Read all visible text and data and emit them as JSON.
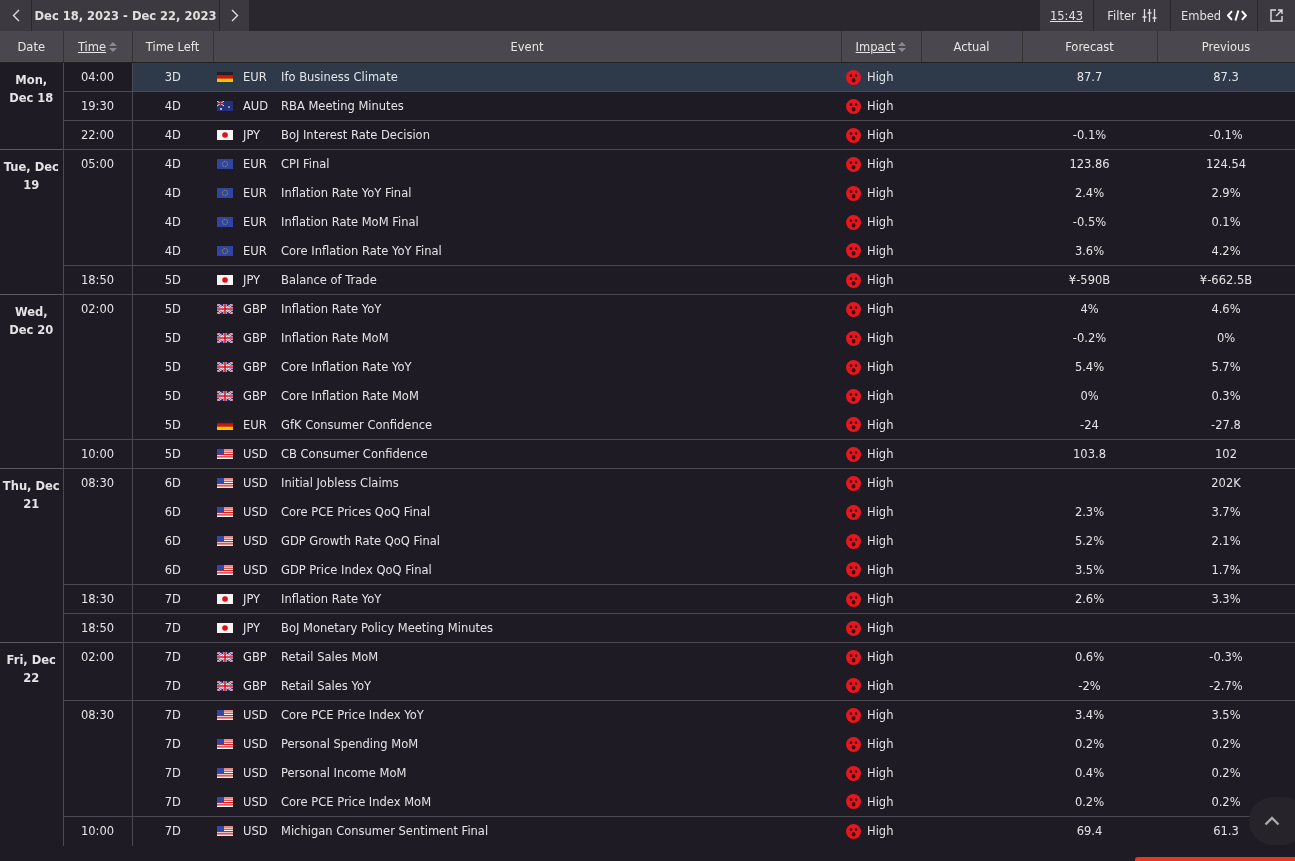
{
  "toolbar": {
    "date_range": "Dec 18, 2023 - Dec 22, 2023",
    "time": "15:43",
    "filter": "Filter",
    "embed": "Embed"
  },
  "table": {
    "columns": [
      {
        "label": "Date",
        "sortable": false
      },
      {
        "label": "Time",
        "sortable": true
      },
      {
        "label": "Time Left",
        "sortable": false
      },
      {
        "label": "Event",
        "sortable": false
      },
      {
        "label": "Impact",
        "sortable": true
      },
      {
        "label": "Actual",
        "sortable": false
      },
      {
        "label": "Forecast",
        "sortable": false
      },
      {
        "label": "Previous",
        "sortable": false
      }
    ],
    "days": [
      {
        "date": "Mon, Dec 18",
        "groups": [
          {
            "time": "04:00",
            "events": [
              {
                "time_left": "3D",
                "kind": "de",
                "currency": "EUR",
                "event": "Ifo Business Climate",
                "impact": "High",
                "forecast": "87.7",
                "previous": "87.3",
                "selected": true
              }
            ]
          },
          {
            "time": "19:30",
            "events": [
              {
                "time_left": "4D",
                "kind": "au",
                "currency": "AUD",
                "event": "RBA Meeting Minutes",
                "impact": "High",
                "selected": false
              }
            ]
          },
          {
            "time": "22:00",
            "events": [
              {
                "time_left": "4D",
                "kind": "jp",
                "currency": "JPY",
                "event": "BoJ Interest Rate Decision",
                "impact": "High",
                "forecast": "-0.1%",
                "previous": "-0.1%",
                "selected": false
              }
            ]
          }
        ]
      },
      {
        "date": "Tue, Dec 19",
        "groups": [
          {
            "time": "05:00",
            "events": [
              {
                "time_left": "4D",
                "kind": "eu",
                "currency": "EUR",
                "event": "CPI Final",
                "impact": "High",
                "forecast": "123.86",
                "previous": "124.54",
                "selected": false
              },
              {
                "time_left": "4D",
                "kind": "eu",
                "currency": "EUR",
                "event": "Inflation Rate YoY Final",
                "impact": "High",
                "forecast": "2.4%",
                "previous": "2.9%",
                "selected": false
              },
              {
                "time_left": "4D",
                "kind": "eu",
                "currency": "EUR",
                "event": "Inflation Rate MoM Final",
                "impact": "High",
                "forecast": "-0.5%",
                "previous": "0.1%",
                "selected": false
              },
              {
                "time_left": "4D",
                "kind": "eu",
                "currency": "EUR",
                "event": "Core Inflation Rate YoY Final",
                "impact": "High",
                "forecast": "3.6%",
                "previous": "4.2%",
                "selected": false
              }
            ]
          },
          {
            "time": "18:50",
            "events": [
              {
                "time_left": "5D",
                "kind": "jp",
                "currency": "JPY",
                "event": "Balance of Trade",
                "impact": "High",
                "forecast": "¥-590B",
                "previous": "¥-662.5B",
                "selected": false
              }
            ]
          }
        ]
      },
      {
        "date": "Wed, Dec 20",
        "groups": [
          {
            "time": "02:00",
            "events": [
              {
                "time_left": "5D",
                "kind": "gb",
                "currency": "GBP",
                "event": "Inflation Rate YoY",
                "impact": "High",
                "forecast": "4%",
                "previous": "4.6%",
                "selected": false
              },
              {
                "time_left": "5D",
                "kind": "gb",
                "currency": "GBP",
                "event": "Inflation Rate MoM",
                "impact": "High",
                "forecast": "-0.2%",
                "previous": "0%",
                "selected": false
              },
              {
                "time_left": "5D",
                "kind": "gb",
                "currency": "GBP",
                "event": "Core Inflation Rate YoY",
                "impact": "High",
                "forecast": "5.4%",
                "previous": "5.7%",
                "selected": false
              },
              {
                "time_left": "5D",
                "kind": "gb",
                "currency": "GBP",
                "event": "Core Inflation Rate MoM",
                "impact": "High",
                "forecast": "0%",
                "previous": "0.3%",
                "selected": false
              },
              {
                "time_left": "5D",
                "kind": "de",
                "currency": "EUR",
                "event": "GfK Consumer Confidence",
                "impact": "High",
                "forecast": "-24",
                "previous": "-27.8",
                "selected": false
              }
            ]
          },
          {
            "time": "10:00",
            "events": [
              {
                "time_left": "5D",
                "kind": "us",
                "currency": "USD",
                "event": "CB Consumer Confidence",
                "impact": "High",
                "forecast": "103.8",
                "previous": "102",
                "selected": false
              }
            ]
          }
        ]
      },
      {
        "date": "Thu, Dec 21",
        "groups": [
          {
            "time": "08:30",
            "events": [
              {
                "time_left": "6D",
                "kind": "us",
                "currency": "USD",
                "event": "Initial Jobless Claims",
                "impact": "High",
                "previous": "202K",
                "selected": false
              },
              {
                "time_left": "6D",
                "kind": "us",
                "currency": "USD",
                "event": "Core PCE Prices QoQ Final",
                "impact": "High",
                "forecast": "2.3%",
                "previous": "3.7%",
                "selected": false
              },
              {
                "time_left": "6D",
                "kind": "us",
                "currency": "USD",
                "event": "GDP Growth Rate QoQ Final",
                "impact": "High",
                "forecast": "5.2%",
                "previous": "2.1%",
                "selected": false
              },
              {
                "time_left": "6D",
                "kind": "us",
                "currency": "USD",
                "event": "GDP Price Index QoQ Final",
                "impact": "High",
                "forecast": "3.5%",
                "previous": "1.7%",
                "selected": false
              }
            ]
          },
          {
            "time": "18:30",
            "events": [
              {
                "time_left": "7D",
                "kind": "jp",
                "currency": "JPY",
                "event": "Inflation Rate YoY",
                "impact": "High",
                "forecast": "2.6%",
                "previous": "3.3%",
                "selected": false
              }
            ]
          },
          {
            "time": "18:50",
            "events": [
              {
                "time_left": "7D",
                "kind": "jp",
                "currency": "JPY",
                "event": "BoJ Monetary Policy Meeting Minutes",
                "impact": "High",
                "selected": false
              }
            ]
          }
        ]
      },
      {
        "date": "Fri, Dec 22",
        "groups": [
          {
            "time": "02:00",
            "events": [
              {
                "time_left": "7D",
                "kind": "gb",
                "currency": "GBP",
                "event": "Retail Sales MoM",
                "impact": "High",
                "forecast": "0.6%",
                "previous": "-0.3%",
                "selected": false
              },
              {
                "time_left": "7D",
                "kind": "gb",
                "currency": "GBP",
                "event": "Retail Sales YoY",
                "impact": "High",
                "forecast": "-2%",
                "previous": "-2.7%",
                "selected": false
              }
            ]
          },
          {
            "time": "08:30",
            "events": [
              {
                "time_left": "7D",
                "kind": "us",
                "currency": "USD",
                "event": "Core PCE Price Index YoY",
                "impact": "High",
                "forecast": "3.4%",
                "previous": "3.5%",
                "selected": false
              },
              {
                "time_left": "7D",
                "kind": "us",
                "currency": "USD",
                "event": "Personal Spending MoM",
                "impact": "High",
                "forecast": "0.2%",
                "previous": "0.2%",
                "selected": false
              },
              {
                "time_left": "7D",
                "kind": "us",
                "currency": "USD",
                "event": "Personal Income MoM",
                "impact": "High",
                "forecast": "0.4%",
                "previous": "0.2%",
                "selected": false
              },
              {
                "time_left": "7D",
                "kind": "us",
                "currency": "USD",
                "event": "Core PCE Price Index MoM",
                "impact": "High",
                "forecast": "0.2%",
                "previous": "0.2%",
                "selected": false
              }
            ]
          },
          {
            "time": "10:00",
            "events": [
              {
                "time_left": "7D",
                "kind": "us",
                "currency": "USD",
                "event": "Michigan Consumer Sentiment Final",
                "impact": "High",
                "forecast": "69.4",
                "previous": "61.3",
                "selected": false
              }
            ]
          }
        ]
      }
    ]
  }
}
